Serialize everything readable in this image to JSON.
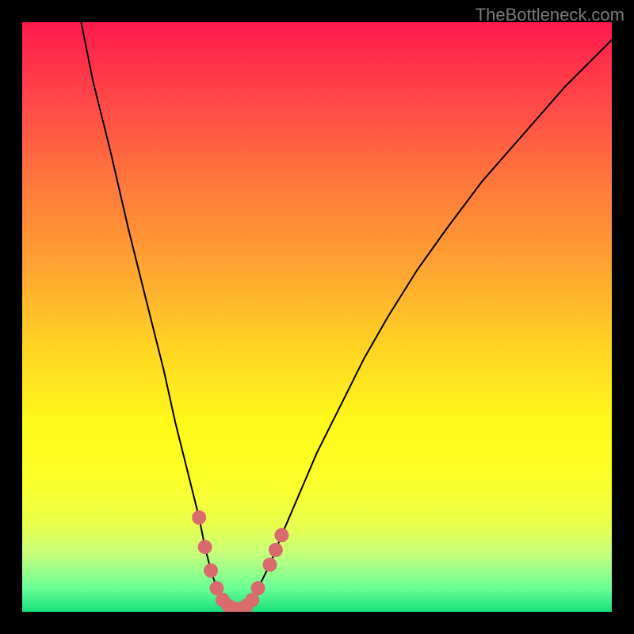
{
  "watermark": "TheBottleneck.com",
  "chart_data": {
    "type": "line",
    "title": "",
    "xlabel": "",
    "ylabel": "",
    "xlim": [
      0,
      100
    ],
    "ylim": [
      0,
      100
    ],
    "series": [
      {
        "name": "bottleneck-curve",
        "x": [
          10,
          12,
          15,
          18,
          21,
          24,
          26,
          28,
          30,
          31,
          32,
          33,
          34,
          35,
          36,
          37,
          38,
          39,
          40,
          42,
          44,
          47,
          50,
          54,
          58,
          62,
          67,
          72,
          78,
          85,
          92,
          100
        ],
        "y": [
          100,
          90,
          78,
          65,
          53,
          41,
          32,
          24,
          16,
          11,
          7,
          4,
          2,
          1,
          0.5,
          0.5,
          1,
          2,
          4,
          8,
          13,
          20,
          27,
          35,
          43,
          50,
          58,
          65,
          73,
          81,
          89,
          97
        ]
      }
    ],
    "highlight_points": {
      "name": "selected-range-dots",
      "color": "#d96a6e",
      "points": [
        {
          "x": 30,
          "y": 16
        },
        {
          "x": 31,
          "y": 11
        },
        {
          "x": 32,
          "y": 7
        },
        {
          "x": 33,
          "y": 4
        },
        {
          "x": 34,
          "y": 2
        },
        {
          "x": 35,
          "y": 1
        },
        {
          "x": 36,
          "y": 0.5
        },
        {
          "x": 37,
          "y": 0.5
        },
        {
          "x": 38,
          "y": 1
        },
        {
          "x": 39,
          "y": 2
        },
        {
          "x": 40,
          "y": 4
        },
        {
          "x": 42,
          "y": 8
        },
        {
          "x": 43,
          "y": 10.5
        },
        {
          "x": 44,
          "y": 13
        }
      ]
    }
  }
}
